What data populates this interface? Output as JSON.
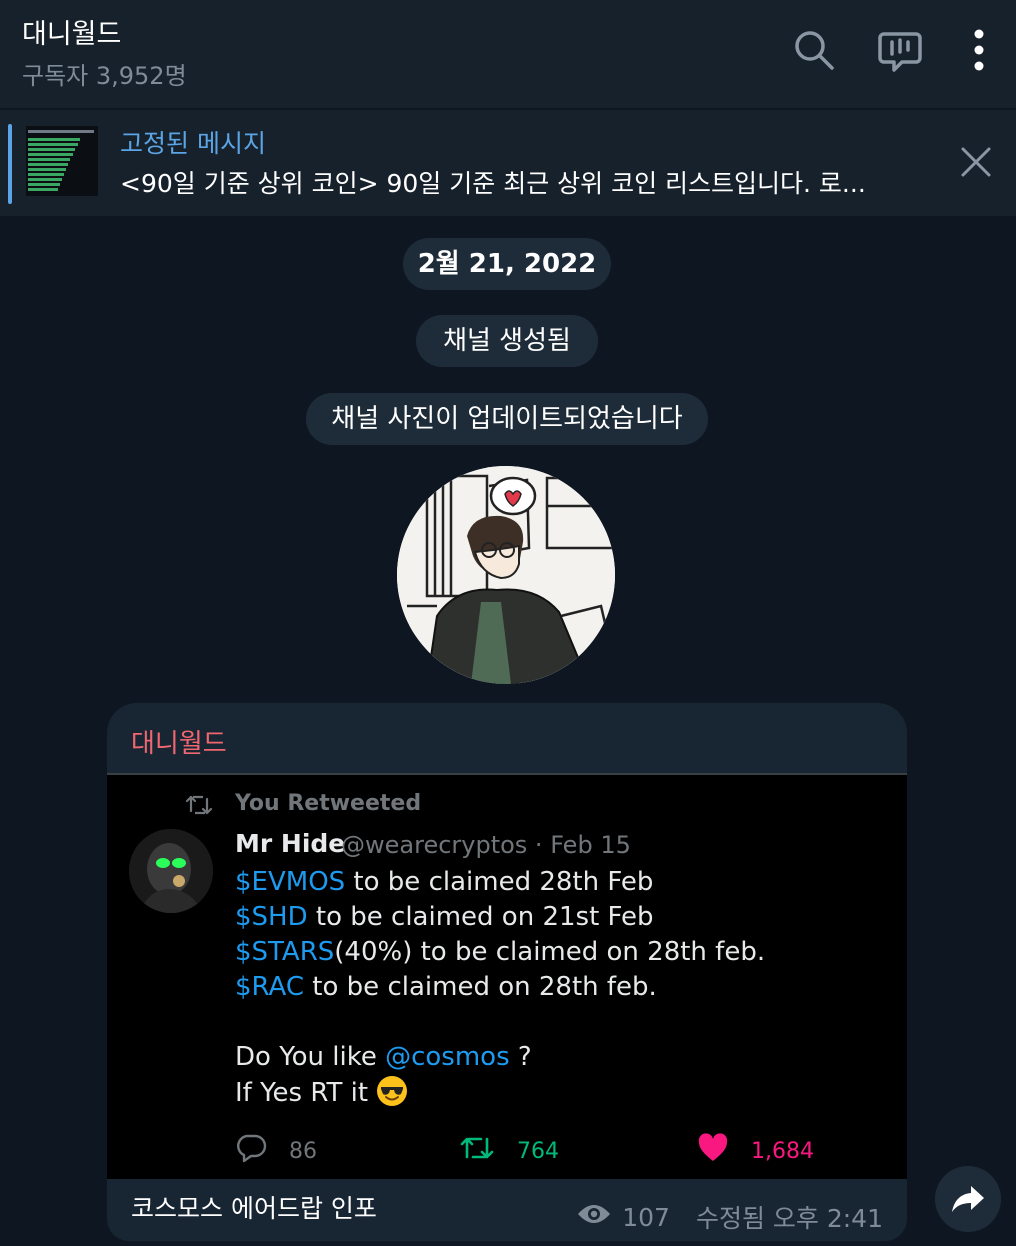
{
  "header": {
    "title": "대니월드",
    "subtitle": "구독자 3,952명"
  },
  "pinned": {
    "label": "고정된 메시지",
    "text": "<90일 기준 상위 코인>  90일 기준 최근 상위 코인 리스트입니다. 로..."
  },
  "service": {
    "date": "2월 21, 2022",
    "created": "채널 생성됨",
    "photo_updated": "채널 사진이 업데이트되었습니다"
  },
  "message": {
    "sender": "대니월드",
    "tweet": {
      "retweet_label": "You Retweeted",
      "name": "Mr Hide",
      "handle_date": "@wearecryptos · Feb 15",
      "lines": [
        {
          "tag": "$EVMOS",
          "rest": " to be claimed 28th Feb"
        },
        {
          "tag": "$SHD",
          "rest": " to be claimed on 21st Feb"
        },
        {
          "tag": "$STARS",
          "rest": "(40%) to be claimed on 28th feb."
        },
        {
          "tag": "$RAC",
          "rest": " to be claimed on 28th feb."
        }
      ],
      "question_pre": "Do You like ",
      "question_mention": "@cosmos",
      "question_post": " ?",
      "closing": "If Yes RT it",
      "replies": "86",
      "retweets": "764",
      "likes": "1,684"
    },
    "caption": "코스모스 에어드랍 인포",
    "views": "107",
    "edited_time": "수정됨 오후 2:41"
  },
  "colors": {
    "accent": "#5ba4e5",
    "sender": "#f06770",
    "retweet": "#00ba7c",
    "like": "#f91880",
    "link": "#1d9bf0"
  }
}
